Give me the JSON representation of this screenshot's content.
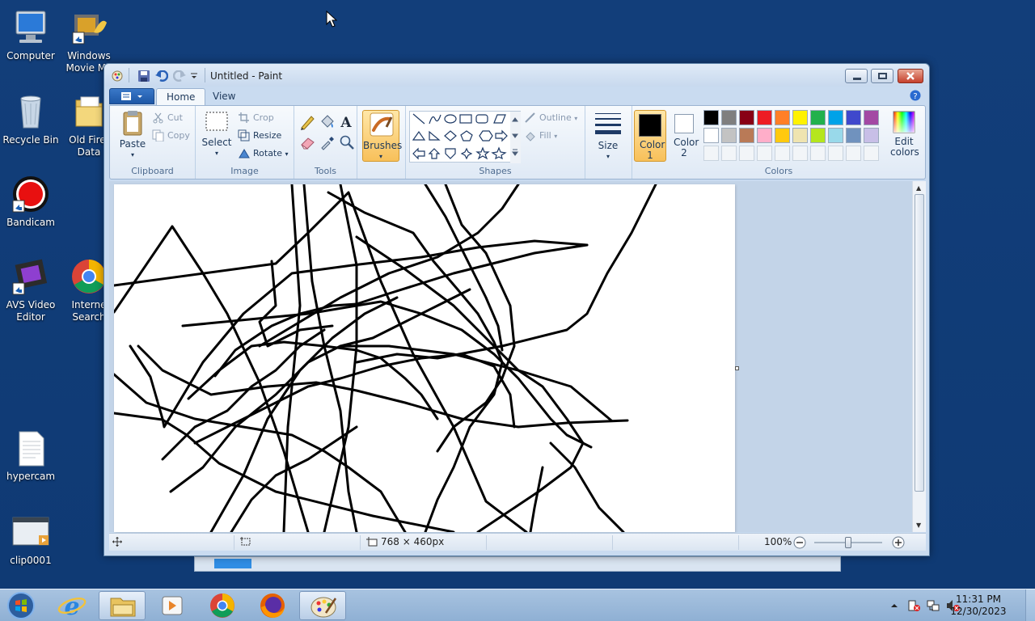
{
  "desktop": {
    "icons": [
      {
        "label": "Computer",
        "icon": "computer-icon"
      },
      {
        "label": "Windows Movie Ma",
        "icon": "movie-maker-icon"
      },
      {
        "label": "Recycle Bin",
        "icon": "recycle-bin-icon"
      },
      {
        "label": "Old Firef Data",
        "icon": "folder-icon"
      },
      {
        "label": "Bandicam",
        "icon": "bandicam-icon"
      },
      {
        "label": "AVS Video Editor",
        "icon": "avs-video-editor-icon"
      },
      {
        "label": "Interne Search",
        "icon": "chrome-icon"
      },
      {
        "label": "hypercam",
        "icon": "text-file-icon"
      },
      {
        "label": "clip0001",
        "icon": "video-file-icon"
      }
    ]
  },
  "window": {
    "title": "Untitled - Paint",
    "tabs": [
      "Home",
      "View"
    ]
  },
  "ribbon": {
    "clipboard": {
      "paste": "Paste",
      "cut": "Cut",
      "copy": "Copy",
      "label": "Clipboard"
    },
    "image": {
      "select": "Select",
      "crop": "Crop",
      "resize": "Resize",
      "rotate": "Rotate",
      "label": "Image"
    },
    "tools": {
      "label": "Tools"
    },
    "brushes": {
      "label": "Brushes"
    },
    "shapes": {
      "outline": "Outline",
      "fill": "Fill",
      "label": "Shapes"
    },
    "size": {
      "label": "Size"
    },
    "colors": {
      "color1": "Color 1",
      "color2": "Color 2",
      "edit": "Edit colors",
      "label": "Colors",
      "color1_value": "#000000",
      "color2_value": "#ffffff",
      "palette_row1": [
        "#000000",
        "#7f7f7f",
        "#880015",
        "#ed1c24",
        "#ff7f27",
        "#fff200",
        "#22b14c",
        "#00a2e8",
        "#3f48cc",
        "#a349a4"
      ],
      "palette_row2": [
        "#ffffff",
        "#c3c3c3",
        "#b97a57",
        "#ffaec9",
        "#ffc90e",
        "#efe4b0",
        "#b5e61d",
        "#99d9ea",
        "#7092be",
        "#c8bfe7"
      ]
    }
  },
  "status": {
    "dimensions": "768 × 460px",
    "zoom": "100%"
  },
  "taskbar": {
    "items": [
      "start-orb-icon",
      "internet-explorer-icon",
      "file-explorer-icon",
      "media-player-icon",
      "chrome-icon",
      "firefox-icon",
      "paint-icon"
    ],
    "time": "11:31 PM",
    "date": "12/30/2023"
  }
}
